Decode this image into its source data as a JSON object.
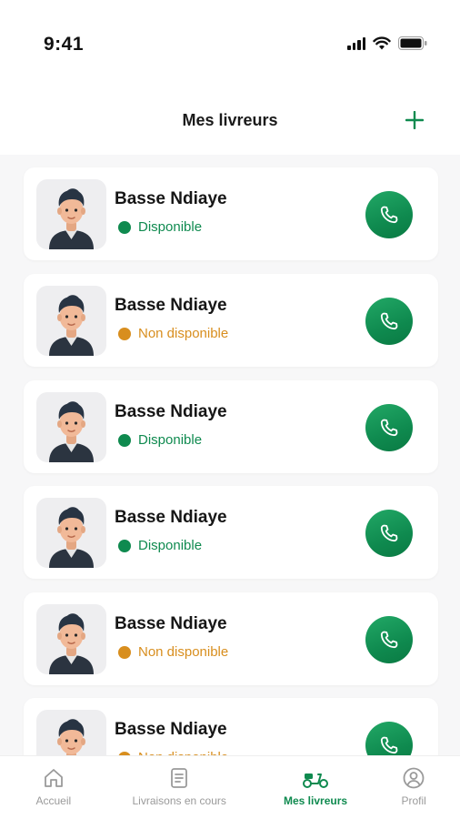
{
  "status_bar": {
    "time": "9:41"
  },
  "header": {
    "title": "Mes livreurs",
    "add_icon": "plus-icon"
  },
  "colors": {
    "brand_green": "#0f8a4f",
    "available": "#0f8a4f",
    "unavailable": "#d88e1e",
    "nav_inactive": "#9a9a9a"
  },
  "drivers": [
    {
      "name": "Basse Ndiaye",
      "status": "Disponible",
      "available": true
    },
    {
      "name": "Basse Ndiaye",
      "status": "Non disponible",
      "available": false
    },
    {
      "name": "Basse Ndiaye",
      "status": "Disponible",
      "available": true
    },
    {
      "name": "Basse Ndiaye",
      "status": "Disponible",
      "available": true
    },
    {
      "name": "Basse Ndiaye",
      "status": "Non disponible",
      "available": false
    },
    {
      "name": "Basse Ndiaye",
      "status": "Non disponible",
      "available": false
    }
  ],
  "bottom_nav": {
    "items": [
      {
        "label": "Accueil",
        "icon": "home-icon",
        "active": false
      },
      {
        "label": "Livraisons en cours",
        "icon": "document-icon",
        "active": false
      },
      {
        "label": "Mes livreurs",
        "icon": "scooter-icon",
        "active": true
      },
      {
        "label": "Profil",
        "icon": "user-circle-icon",
        "active": false
      }
    ]
  }
}
